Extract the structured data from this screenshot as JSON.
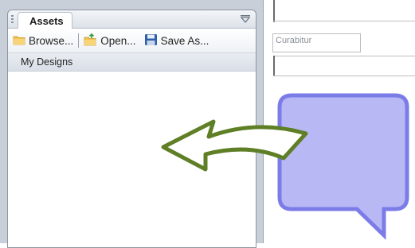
{
  "assets_panel": {
    "tab_label": "Assets",
    "menu_icon": "panel-menu-chevron",
    "toolbar": {
      "browse_label": "Browse...",
      "open_label": "Open...",
      "save_as_label": "Save As..."
    },
    "section_label": "My Designs"
  },
  "designer": {
    "textbox_text": "Curabitur"
  },
  "colors": {
    "arrow": "#5f7f26",
    "bubble_fill": "#b8b8f5",
    "bubble_stroke": "#7c7ce8"
  }
}
